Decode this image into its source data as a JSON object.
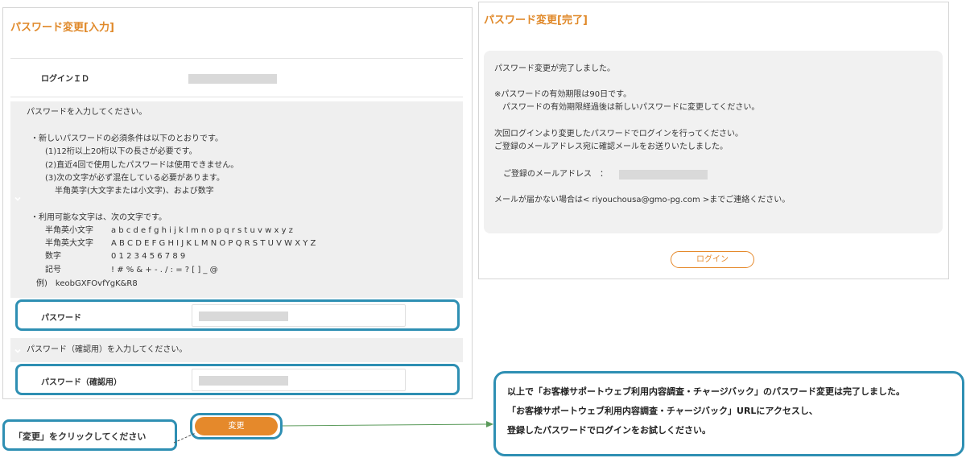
{
  "input_panel": {
    "title": "パスワード変更[入力]",
    "login_id_label": "ログインＩＤ",
    "instruction": "パスワードを入力してください。",
    "requirements_heading": "・新しいパスワードの必須条件は以下のとおりです。",
    "requirements": [
      "(1)12桁以上20桁以下の長さが必要です。",
      "(2)直近4回で使用したパスワードは使用できません。",
      "(3)次の文字が必ず混在している必要があります。"
    ],
    "requirement_detail": "半角英字(大文字または小文字)、および数字",
    "usable_heading": "・利用可能な文字は、次の文字です。",
    "charsets": [
      {
        "label": "半角英小文字",
        "chars": "a b c d e f g h i j k l m n o p q r s t u v w x y z"
      },
      {
        "label": "半角英大文字",
        "chars": "A B C D E F G H I J K L M N O P Q R S T U V W X Y Z"
      },
      {
        "label": "数字",
        "chars": "0 1 2 3 4 5 6 7 8 9"
      },
      {
        "label": "記号",
        "chars": "! # % & + - . / : = ? [ ] _ @"
      }
    ],
    "example": "例)　keobGXFOvfYgK&R8",
    "password_label": "パスワード",
    "confirm_instruction": "パスワード（確認用）を入力してください。",
    "confirm_label": "パスワード（確認用）",
    "change_button": "変更"
  },
  "complete_panel": {
    "title": "パスワード変更[完了]",
    "message_lines": [
      "パスワード変更が完了しました。",
      "※パスワードの有効期限は90日です。",
      "　パスワードの有効期限経過後は新しいパスワードに変更してください。",
      "次回ログインより変更したパスワードでログインを行ってください。",
      "ご登録のメールアドレス宛に確認メールをお送りいたしました。",
      "ご登録のメールアドレス　：",
      "メールが届かない場合は< riyouchousa@gmo-pg.com >までご連絡ください。"
    ],
    "login_button": "ログイン"
  },
  "annotations": {
    "click_note": "「変更」をクリックしてください",
    "callout_lines": [
      "以上で「お客様サポートウェブ利用内容調査・チャージバック」のパスワード変更は完了しました。",
      "「お客様サポートウェブ利用内容調査・チャージバック」URLにアクセスし、",
      "登録したパスワードでログインをお試しください。"
    ]
  },
  "colors": {
    "accent_orange": "#e5892b",
    "annotation_blue": "#2e8fb3",
    "arrow_green": "#5a9a5a"
  },
  "icons": [
    "chevron-down-icon",
    "arrow-right-icon"
  ]
}
